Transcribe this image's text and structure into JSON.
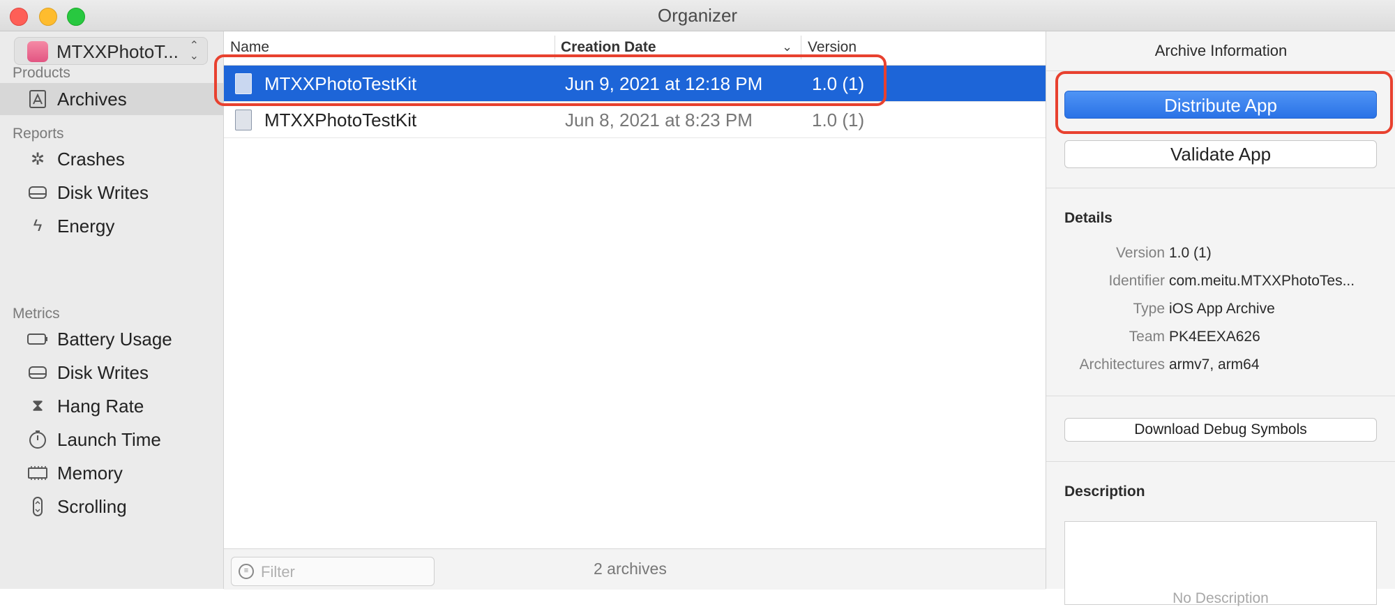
{
  "window": {
    "title": "Organizer"
  },
  "sidebar": {
    "scheme": "MTXXPhotoT...",
    "sections": {
      "products": "Products",
      "reports": "Reports",
      "metrics": "Metrics"
    },
    "products_items": [
      {
        "label": "Archives",
        "icon": "archive-icon",
        "selected": true
      }
    ],
    "reports_items": [
      {
        "label": "Crashes",
        "icon": "crash-icon"
      },
      {
        "label": "Disk Writes",
        "icon": "disk-icon"
      },
      {
        "label": "Energy",
        "icon": "energy-icon"
      }
    ],
    "metrics_items": [
      {
        "label": "Battery Usage",
        "icon": "battery-icon"
      },
      {
        "label": "Disk Writes",
        "icon": "disk-icon"
      },
      {
        "label": "Hang Rate",
        "icon": "hourglass-icon"
      },
      {
        "label": "Launch Time",
        "icon": "stopwatch-icon"
      },
      {
        "label": "Memory",
        "icon": "memory-icon"
      },
      {
        "label": "Scrolling",
        "icon": "scrolling-icon"
      }
    ]
  },
  "table": {
    "columns": {
      "name": "Name",
      "date": "Creation Date",
      "version": "Version"
    },
    "rows": [
      {
        "name": "MTXXPhotoTestKit",
        "date": "Jun 9, 2021 at 12:18 PM",
        "version": "1.0 (1)",
        "selected": true
      },
      {
        "name": "MTXXPhotoTestKit",
        "date": "Jun 8, 2021 at 8:23 PM",
        "version": "1.0 (1)",
        "selected": false
      }
    ],
    "filter_placeholder": "Filter",
    "count": "2 archives"
  },
  "inspector": {
    "title": "Archive Information",
    "distribute": "Distribute App",
    "validate": "Validate App",
    "details_header": "Details",
    "details": [
      {
        "key": "Version",
        "value": "1.0 (1)"
      },
      {
        "key": "Identifier",
        "value": "com.meitu.MTXXPhotoTes..."
      },
      {
        "key": "Type",
        "value": "iOS App Archive"
      },
      {
        "key": "Team",
        "value": "PK4EEXA626"
      },
      {
        "key": "Architectures",
        "value": "armv7, arm64"
      }
    ],
    "download_symbols": "Download Debug Symbols",
    "description_header": "Description",
    "description_placeholder": "No Description"
  },
  "colors": {
    "selection": "#1d65d8",
    "annotation": "#e8412f",
    "primary_button": "#2a72e6"
  }
}
